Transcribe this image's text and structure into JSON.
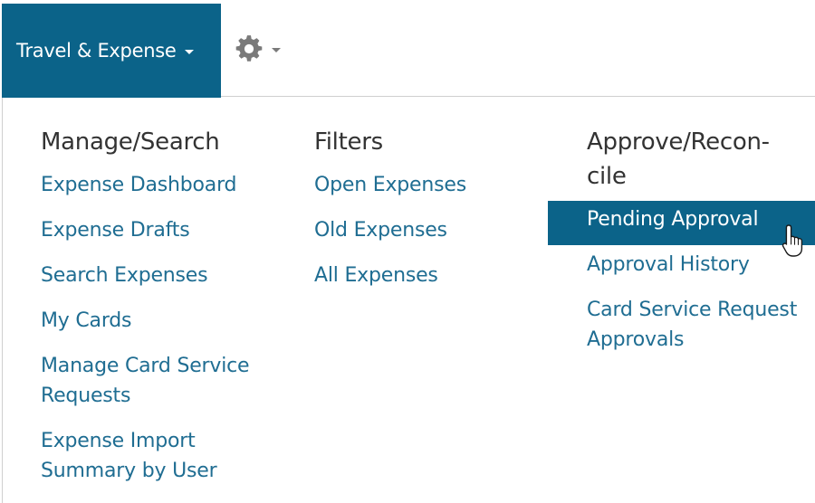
{
  "header": {
    "active_menu_label": "Travel & Expense"
  },
  "icons": {
    "gear": "gear-icon",
    "caret": "chevron-down-icon",
    "cursor": "hand-pointer-icon"
  },
  "colors": {
    "accent": "#0b6389",
    "link": "#1f6d92",
    "heading": "#333333"
  },
  "menu": {
    "columns": [
      {
        "heading": "Manage/Search",
        "items": [
          "Expense Dashboard",
          "Expense Drafts",
          "Search Expenses",
          "My Cards",
          "Manage Card Service Requests",
          "Expense Import Summary by User"
        ]
      },
      {
        "heading": "Filters",
        "items": [
          "Open Expenses",
          "Old Expenses",
          "All Expenses"
        ]
      },
      {
        "heading": "Approve/Recon­cile",
        "items": [
          "Pending Approval",
          "Approval History",
          "Card Service Request Approvals"
        ]
      }
    ],
    "highlighted_item": "Pending Approval"
  }
}
